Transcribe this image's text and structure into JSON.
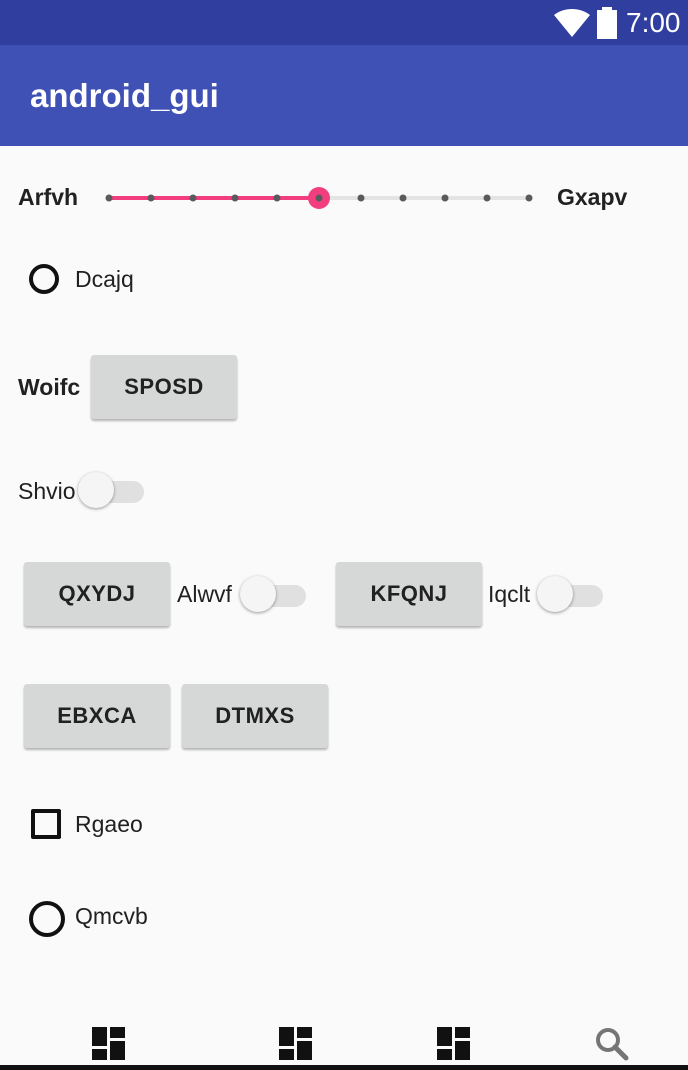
{
  "status_bar": {
    "time": "7:00",
    "icons": [
      "wifi-icon",
      "battery-icon"
    ]
  },
  "app_bar": {
    "title": "android_gui",
    "color": "#3f51b5"
  },
  "seekbar": {
    "left_label": "Arfvh",
    "right_label": "Gxapv",
    "progress_fraction": 0.5,
    "tick_count": 11,
    "accent_color": "#f23e7e"
  },
  "radio_dcajq": {
    "label": "Dcajq",
    "checked": false
  },
  "row_woifc": {
    "label": "Woifc",
    "button_label": "SPOSD"
  },
  "switch_shvio": {
    "label": "Shvio",
    "on": false
  },
  "row_buttons_1": {
    "button1_label": "QXYDJ",
    "switch1_label": "Alwvf",
    "button2_label": "KFQNJ",
    "switch2_label": "Iqclt"
  },
  "row_buttons_2": {
    "button1_label": "EBXCA",
    "button2_label": "DTMXS"
  },
  "checkbox_rgaeo": {
    "label": "Rgaeo",
    "checked": false
  },
  "radio_qmcvb": {
    "label": "Qmcvb",
    "checked": false
  },
  "bottom_nav": {
    "items": [
      "dashboard-icon",
      "dashboard-icon",
      "dashboard-icon",
      "search-icon"
    ]
  }
}
